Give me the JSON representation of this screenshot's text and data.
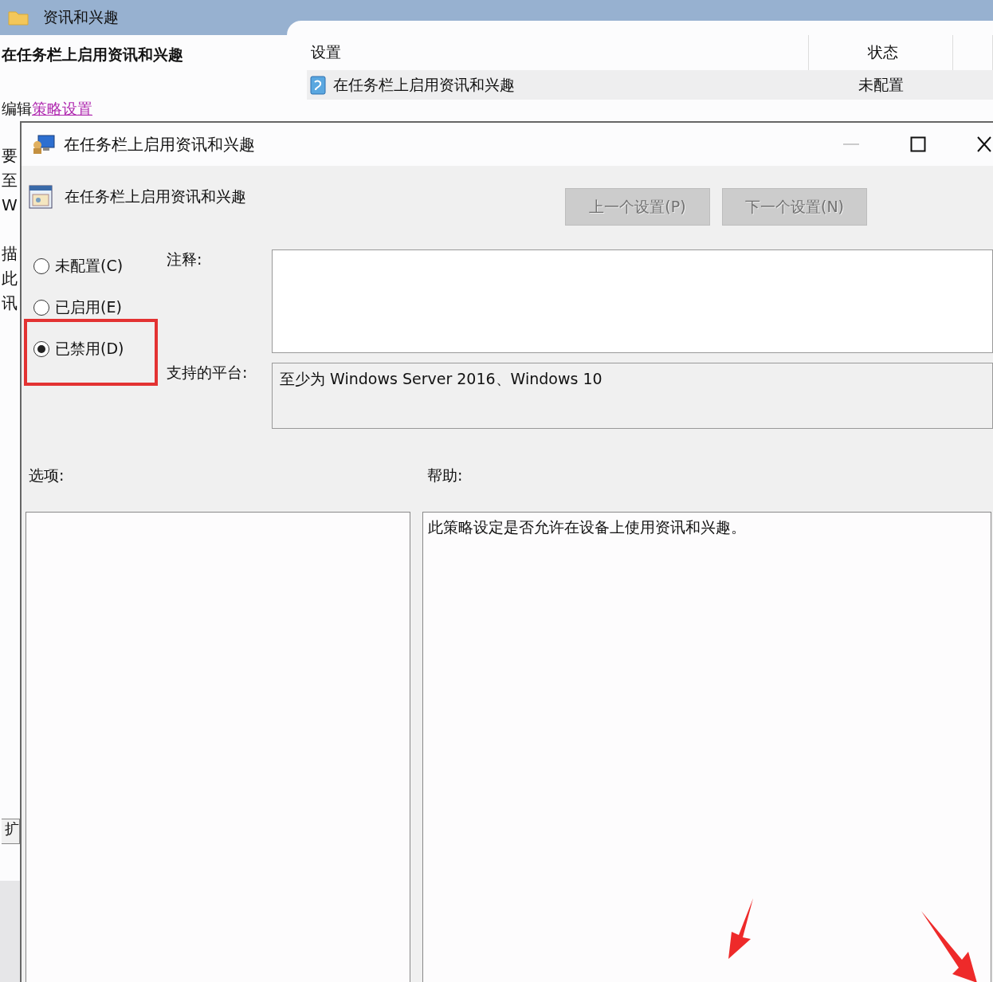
{
  "background_window": {
    "title": "资讯和兴趣",
    "policy_title": "在任务栏上启用资讯和兴趣",
    "edit_prefix": "编辑",
    "edit_link": "策略设置",
    "description_fragments": [
      "要",
      "至",
      "W",
      "描",
      "此",
      "讯"
    ],
    "side_tab": "扩",
    "table": {
      "columns": [
        "设置",
        "状态"
      ],
      "rows": [
        {
          "setting": "在任务栏上启用资讯和兴趣",
          "state": "未配置",
          "selected": true
        }
      ]
    }
  },
  "dialog": {
    "title": "在任务栏上启用资讯和兴趣",
    "policy_title": "在任务栏上启用资讯和兴趣",
    "buttons": [
      {
        "label": "上一个设置(P)",
        "disabled": true
      },
      {
        "label": "下一个设置(N)",
        "disabled": true
      }
    ],
    "options": [
      {
        "label": "未配置(C)",
        "selected": false
      },
      {
        "label": "已启用(E)",
        "selected": false
      },
      {
        "label": "已禁用(D)",
        "selected": true
      }
    ],
    "comment_label": "注释:",
    "platform_label": "支持的平台:",
    "platform": "至少为 Windows Server 2016、Windows 10",
    "options_label": "选项:",
    "help_label": "帮助:",
    "help_text": "此策略设定是否允许在设备上使用资讯和兴趣。"
  }
}
